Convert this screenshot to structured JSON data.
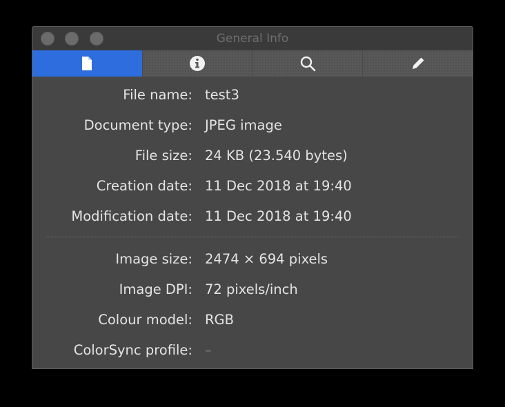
{
  "window": {
    "title": "General Info"
  },
  "tabs": [
    {
      "icon": "document-icon",
      "active": true
    },
    {
      "icon": "info-icon",
      "active": false
    },
    {
      "icon": "search-icon",
      "active": false
    },
    {
      "icon": "pencil-icon",
      "active": false
    }
  ],
  "colors": {
    "active_tab": "#2e6ddd",
    "panel": "#474747",
    "text": "#e4e4e4"
  },
  "file_info": [
    {
      "label": "File name:",
      "value": "test3"
    },
    {
      "label": "Document type:",
      "value": "JPEG image"
    },
    {
      "label": "File size:",
      "value": "24 KB (23.540 bytes)"
    },
    {
      "label": "Creation date:",
      "value": "11 Dec 2018 at 19:40"
    },
    {
      "label": "Modification date:",
      "value": "11 Dec 2018 at 19:40"
    }
  ],
  "image_info": [
    {
      "label": "Image size:",
      "value": "2474 × 694 pixels"
    },
    {
      "label": "Image DPI:",
      "value": "72 pixels/inch"
    },
    {
      "label": "Colour model:",
      "value": "RGB"
    },
    {
      "label": "ColorSync profile:",
      "value": "–"
    }
  ]
}
